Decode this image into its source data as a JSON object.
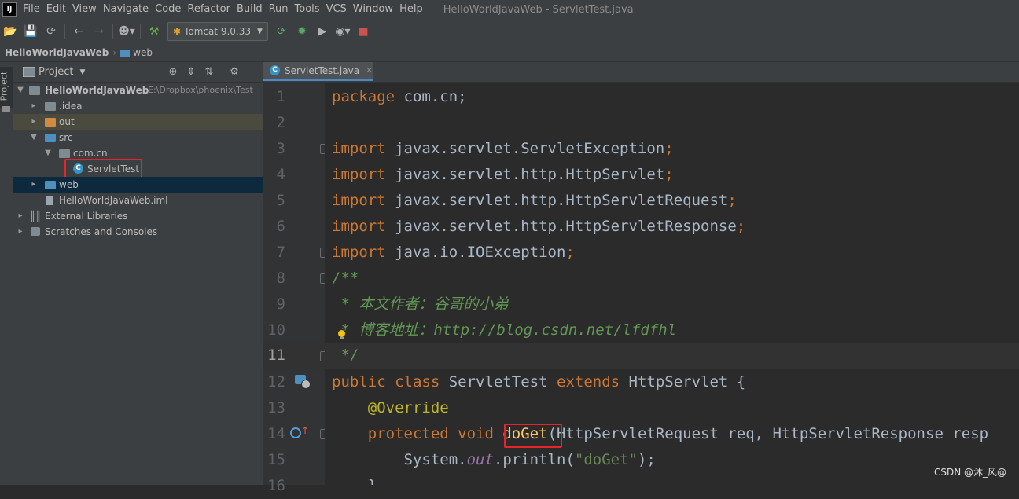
{
  "menubar": {
    "logo": "IJ",
    "items": [
      "File",
      "Edit",
      "View",
      "Navigate",
      "Code",
      "Refactor",
      "Build",
      "Run",
      "Tools",
      "VCS",
      "Window",
      "Help"
    ],
    "window_title": "HelloWorldJavaWeb - ServletTest.java"
  },
  "toolbar": {
    "run_config": "Tomcat 9.0.33",
    "icons": [
      "folder-open-icon",
      "save-icon",
      "sync-icon",
      "back-icon",
      "forward-icon",
      "user-icon",
      "build-hammer-icon",
      "rerun-icon",
      "debug-icon",
      "coverage-icon",
      "profile-icon",
      "stop-icon"
    ]
  },
  "navbar": {
    "project": "HelloWorldJavaWeb",
    "folder": "web"
  },
  "sidebar": {
    "vertical_tab": "Project"
  },
  "project_panel": {
    "title": "Project",
    "tree": [
      {
        "label": "HelloWorldJavaWeb",
        "path": "E:\\Dropbox\\phoenix\\Test"
      },
      {
        "label": ".idea"
      },
      {
        "label": "out"
      },
      {
        "label": "src"
      },
      {
        "label": "com.cn"
      },
      {
        "label": "ServletTest"
      },
      {
        "label": "web"
      },
      {
        "label": "HelloWorldJavaWeb.iml"
      },
      {
        "label": "External Libraries"
      },
      {
        "label": "Scratches and Consoles"
      }
    ]
  },
  "editor": {
    "tab": "ServletTest.java",
    "current_line": 11,
    "line_numbers": [
      "1",
      "2",
      "3",
      "4",
      "5",
      "6",
      "7",
      "8",
      "9",
      "10",
      "11",
      "12",
      "13",
      "14",
      "15",
      "16"
    ]
  },
  "code": {
    "l1": "package com.cn;",
    "l3_kw": "import",
    "l3_pkg": " javax.servlet.ServletException",
    "l3_semi": ";",
    "l4_kw": "import",
    "l4_pkg": " javax.servlet.http.HttpServlet",
    "l4_semi": ";",
    "l5_kw": "import",
    "l5_pkg": " javax.servlet.http.HttpServletRequest",
    "l5_semi": ";",
    "l6_kw": "import",
    "l6_pkg": " javax.servlet.http.HttpServletResponse",
    "l6_semi": ";",
    "l7_kw": "import",
    "l7_pkg": " java.io.IOException",
    "l7_semi": ";",
    "l8": "/**",
    "l9": " * 本文作者：谷哥的小弟",
    "l10": " * 博客地址：http://blog.csdn.net/lfdfhl",
    "l11": " */",
    "l12_kw": "public class",
    "l12_name": " ServletTest ",
    "l12_ext": "extends",
    "l12_rest": " HttpServlet {",
    "l13": "    @Override",
    "l14_kw": "    protected void",
    "l14_sp": " ",
    "l14_method": "doGet",
    "l14_rest": "(HttpServletRequest req, HttpServletResponse resp",
    "l15_a": "        System.",
    "l15_field": "out",
    "l15_b": ".println(",
    "l15_str": "\"doGet\"",
    "l15_c": ");",
    "l16": "    }"
  },
  "watermark": "CSDN @沐_风@",
  "colors": {
    "keyword": "#cc7832",
    "comment": "#629755",
    "annotation": "#bbb529",
    "method": "#ffc66d",
    "string": "#6a8759",
    "highlight_box": "#e8242b"
  }
}
